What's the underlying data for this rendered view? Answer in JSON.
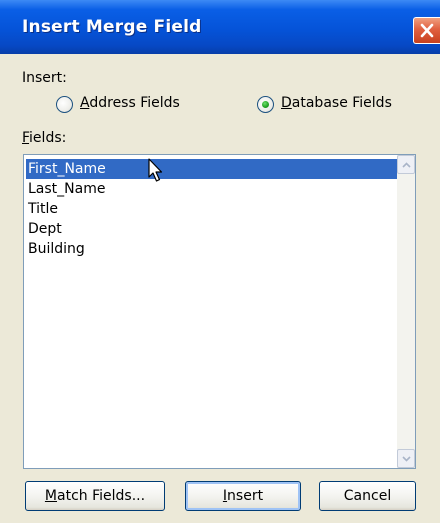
{
  "dialog": {
    "title": "Insert Merge Field"
  },
  "insert_group": {
    "label": "Insert:",
    "options": [
      {
        "label": "Address Fields",
        "accelerator": "A",
        "rest": "ddress Fields",
        "selected": false
      },
      {
        "label": "Database Fields",
        "accelerator": "D",
        "rest": "atabase Fields",
        "selected": true
      }
    ]
  },
  "fields": {
    "label": "Fields:",
    "accelerator": "F",
    "rest": "ields:",
    "items": [
      "First_Name",
      "Last_Name",
      "Title",
      "Dept",
      "Building"
    ],
    "selected_index": 0
  },
  "buttons": {
    "match_fields": {
      "label": "Match Fields...",
      "accelerator": "M",
      "rest": "atch Fields..."
    },
    "insert": {
      "label": "Insert",
      "accelerator": "I",
      "rest": "nsert"
    },
    "cancel": {
      "label": "Cancel"
    }
  },
  "colors": {
    "titlebar": "#0553d8",
    "selection": "#316ac5",
    "dialog_bg": "#ece9d8"
  }
}
